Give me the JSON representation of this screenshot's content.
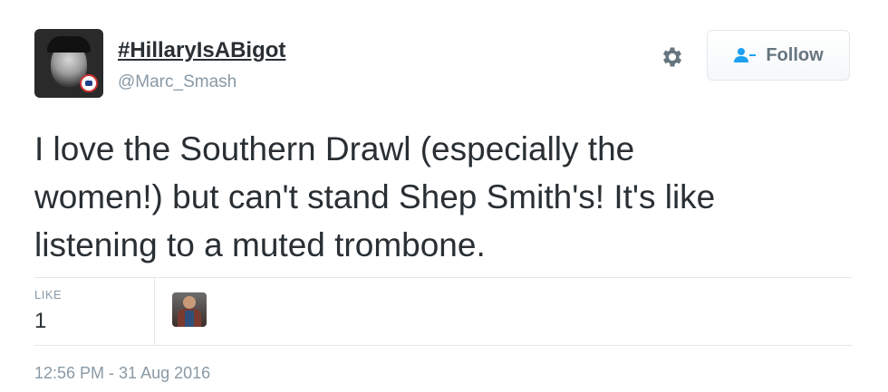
{
  "user": {
    "display_name": "#HillaryIsABigot",
    "screen_name": "@Marc_Smash",
    "avatar_icon": "user-avatar-icon"
  },
  "header": {
    "settings_icon": "gear-icon",
    "follow_label": "Follow",
    "follow_icon": "add-user-icon"
  },
  "tweet": {
    "text": "I love the Southern Drawl (especially the\nwomen!) but can't stand Shep Smith's! It's like\nlistening to a muted trombone."
  },
  "stats": {
    "like_label": "LIKE",
    "like_count": "1"
  },
  "footer": {
    "timestamp": "12:56 PM - 31 Aug 2016"
  },
  "colors": {
    "text": "#292f33",
    "muted": "#8899a6",
    "border": "#e1e8ed",
    "follow_text": "#66757f",
    "follow_icon": "#1da1f2"
  }
}
